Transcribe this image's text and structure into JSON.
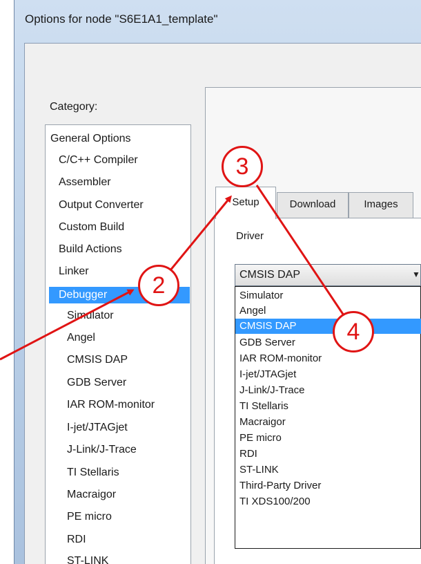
{
  "window": {
    "title": "Options for node \"S6E1A1_template\""
  },
  "category": {
    "label": "Category:",
    "selected_index": 7,
    "items": [
      "General Options",
      "C/C++ Compiler",
      "Assembler",
      "Output Converter",
      "Custom Build",
      "Build Actions",
      "Linker",
      "Debugger",
      "Simulator",
      "Angel",
      "CMSIS DAP",
      "GDB Server",
      "IAR ROM-monitor",
      "I-jet/JTAGjet",
      "J-Link/J-Trace",
      "TI Stellaris",
      "Macraigor",
      "PE micro",
      "RDI",
      "ST-LINK"
    ]
  },
  "tabs": [
    {
      "label": "Setup",
      "active": true
    },
    {
      "label": "Download",
      "active": false
    },
    {
      "label": "Images",
      "active": false
    }
  ],
  "driver": {
    "label": "Driver",
    "selected": "CMSIS DAP",
    "options": [
      "Simulator",
      "Angel",
      "CMSIS DAP",
      "GDB Server",
      "IAR ROM-monitor",
      "I-jet/JTAGjet",
      "J-Link/J-Trace",
      "TI Stellaris",
      "Macraigor",
      "PE micro",
      "RDI",
      "ST-LINK",
      "Third-Party Driver",
      "TI XDS100/200"
    ],
    "highlighted_index": 2
  },
  "callouts": {
    "step2": "2",
    "step3": "3",
    "step4": "4"
  },
  "colors": {
    "selection": "#3399ff",
    "annotation": "#e01414"
  }
}
